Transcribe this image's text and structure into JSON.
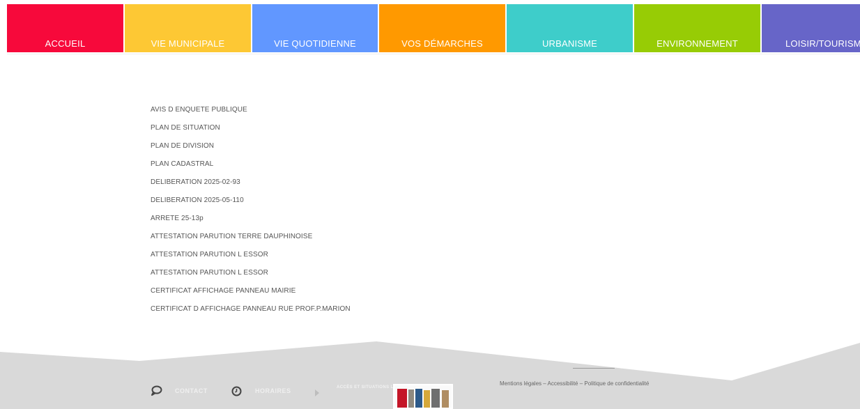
{
  "nav": {
    "items": [
      {
        "label": "ACCUEIL",
        "color": "#f7093b"
      },
      {
        "label": "VIE MUNICIPALE",
        "color": "#fdc834"
      },
      {
        "label": "VIE QUOTIDIENNE",
        "color": "#6197ff"
      },
      {
        "label": "VOS DÉMARCHES",
        "color": "#ff9900"
      },
      {
        "label": "URBANISME",
        "color": "#3ecdca"
      },
      {
        "label": "ENVIRONNEMENT",
        "color": "#97cc05"
      },
      {
        "label": "LOISIR/TOURISM",
        "color": "#6765c8"
      }
    ]
  },
  "documents": [
    "AVIS D ENQUETE PUBLIQUE",
    "PLAN DE SITUATION",
    "PLAN DE DIVISION",
    "PLAN CADASTRAL",
    "DELIBERATION 2025-02-93",
    "DELIBERATION 2025-05-110",
    "ARRETE 25-13p",
    "ATTESTATION PARUTION TERRE DAUPHINOISE",
    "ATTESTATION PARUTION L ESSOR",
    "ATTESTATION PARUTION L ESSOR",
    "CERTIFICAT AFFICHAGE PANNEAU MAIRIE",
    "CERTIFICAT D AFFICHAGE PANNEAU RUE PROF.P.MARION"
  ],
  "footer": {
    "contact_label": "CONTACT",
    "hours_label": "HORAIRES",
    "access_label": "ACCÈS ET SITUATIONS LA",
    "legal_text": "Mentions légales – Accessibilité – Politique de confidentialité",
    "background_color": "#d9d9d9"
  }
}
